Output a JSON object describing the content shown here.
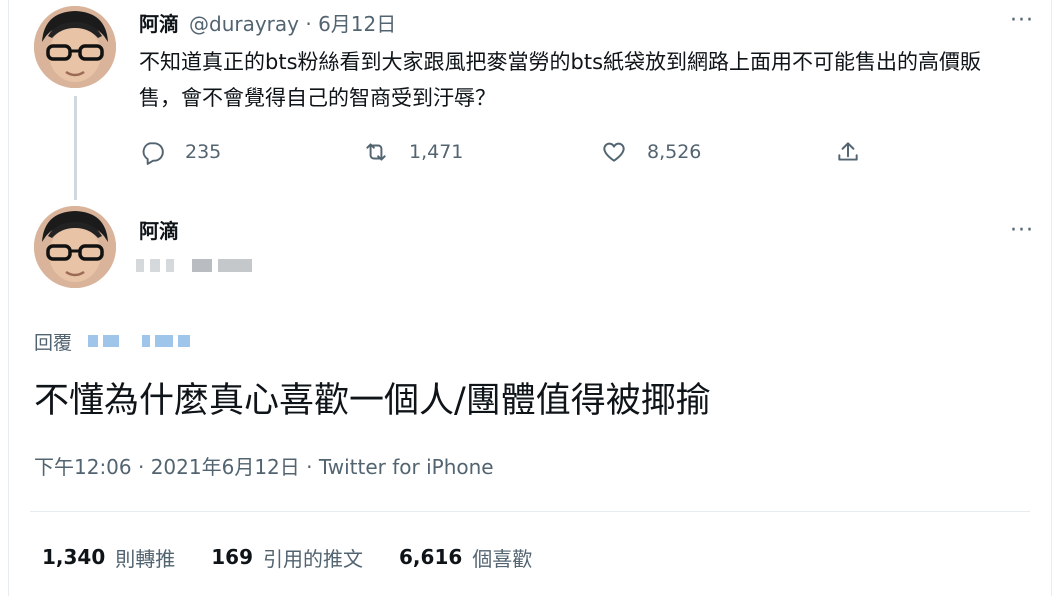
{
  "tweet1": {
    "display_name": "阿滴",
    "handle": "@durayray",
    "date": "6月12日",
    "more": "···",
    "text": "不知道真正的bts粉絲看到大家跟風把麥當勞的bts紙袋放到網路上面用不可能售出的高價販售，會不會覺得自己的智商受到汙辱？",
    "actions": {
      "reply_count": "235",
      "retweet_count": "1,471",
      "like_count": "8,526"
    }
  },
  "tweet2": {
    "display_name": "阿滴",
    "more": "···",
    "reply_prefix": "回覆",
    "text": "不懂為什麼真心喜歡一個人/團體值得被揶揄",
    "timestamp": "下午12:06 · 2021年6月12日 · Twitter for iPhone",
    "stats": {
      "retweets_num": "1,340",
      "retweets_label": "則轉推",
      "quotes_num": "169",
      "quotes_label": "引用的推文",
      "likes_num": "6,616",
      "likes_label": "個喜歡"
    }
  },
  "icons": {
    "reply": "reply-icon",
    "retweet": "retweet-icon",
    "like": "heart-icon",
    "share": "share-icon",
    "more": "more-dots-icon"
  },
  "colors": {
    "text_primary": "#0f1419",
    "text_secondary": "#536471",
    "mention_blur": "#9fc6ea",
    "divider": "#e6ecf0"
  }
}
